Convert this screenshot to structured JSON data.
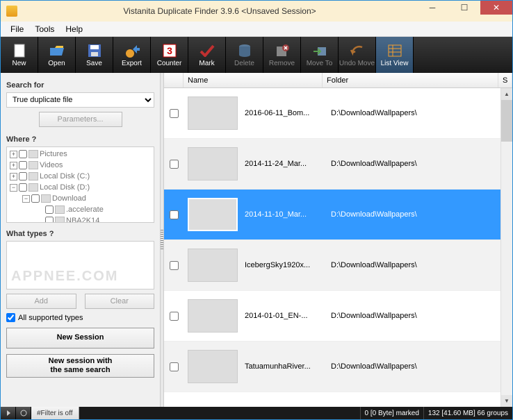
{
  "window": {
    "title": "Vistanita Duplicate Finder 3.9.6 <Unsaved Session>"
  },
  "menu": {
    "file": "File",
    "tools": "Tools",
    "help": "Help"
  },
  "toolbar": {
    "new": "New",
    "open": "Open",
    "save": "Save",
    "export": "Export",
    "counter": "Counter",
    "mark": "Mark",
    "delete": "Delete",
    "remove": "Remove",
    "moveto": "Move To",
    "undo": "Undo Move",
    "listview": "List View"
  },
  "sidebar": {
    "search_for": "Search for",
    "search_combo": "True duplicate file",
    "parameters": "Parameters...",
    "where": "Where ?",
    "tree": [
      {
        "indent": 0,
        "expand": "+",
        "label": "Pictures"
      },
      {
        "indent": 0,
        "expand": "+",
        "label": "Videos"
      },
      {
        "indent": 0,
        "expand": "+",
        "label": "Local Disk (C:)"
      },
      {
        "indent": 0,
        "expand": "−",
        "label": "Local Disk (D:)"
      },
      {
        "indent": 1,
        "expand": "−",
        "label": "Download"
      },
      {
        "indent": 2,
        "expand": "",
        "label": ".accelerate"
      },
      {
        "indent": 2,
        "expand": "",
        "label": "NBA2K14"
      }
    ],
    "what_types": "What types ?",
    "watermark": "APPNEE.COM",
    "add": "Add",
    "clear": "Clear",
    "all_types": "All supported types",
    "new_session": "New Session",
    "new_session_same": "New session with\nthe same search"
  },
  "columns": {
    "name": "Name",
    "folder": "Folder",
    "size": "S"
  },
  "rows": [
    {
      "name": "2016-06-11_Bom...",
      "folder": "D:\\Download\\Wallpapers\\",
      "thumb": "th1",
      "sel": false,
      "alt": false
    },
    {
      "name": "2014-11-24_Mar...",
      "folder": "D:\\Download\\Wallpapers\\",
      "thumb": "th2",
      "sel": false,
      "alt": true
    },
    {
      "name": "2014-11-10_Mar...",
      "folder": "D:\\Download\\Wallpapers\\",
      "thumb": "th3",
      "sel": true,
      "alt": false
    },
    {
      "name": "IcebergSky1920x...",
      "folder": "D:\\Download\\Wallpapers\\",
      "thumb": "th4",
      "sel": false,
      "alt": true
    },
    {
      "name": "2014-01-01_EN-...",
      "folder": "D:\\Download\\Wallpapers\\",
      "thumb": "th5",
      "sel": false,
      "alt": false
    },
    {
      "name": "TatuamunhaRiver...",
      "folder": "D:\\Download\\Wallpapers\\",
      "thumb": "th6",
      "sel": false,
      "alt": true
    }
  ],
  "status": {
    "filter": "#Filter is off",
    "marked": "0 [0 Byte] marked",
    "groups": "132 [41.60 MB] 66 groups"
  }
}
